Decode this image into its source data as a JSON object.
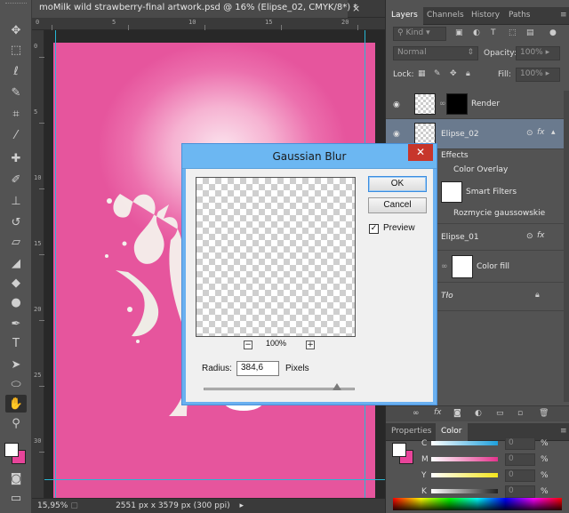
{
  "document": {
    "tab_title": "moMilk wild strawberry-final artwork.psd @ 16% (Elipse_02, CMYK/8*) *",
    "close": "×"
  },
  "status": {
    "zoom": "15,95%",
    "doc_info": "2551 px x 3579 px (300 ppi)"
  },
  "rulers": {
    "top": [
      "0",
      "5",
      "10",
      "15",
      "20"
    ],
    "left": [
      "0",
      "5",
      "10",
      "15",
      "20",
      "25",
      "30"
    ]
  },
  "layers_panel": {
    "tabs": [
      "Layers",
      "Channels",
      "History",
      "Paths"
    ],
    "filter_kind": "Kind",
    "blend_mode": "Normal",
    "opacity_label": "Opacity:",
    "opacity_value": "100%",
    "lock_label": "Lock:",
    "fill_label": "Fill:",
    "fill_value": "100%",
    "layers": [
      {
        "name": "Render"
      },
      {
        "name": "Elipse_02",
        "fx": "fx"
      },
      {
        "name": "Effects"
      },
      {
        "name": "Color Overlay"
      },
      {
        "name": "Smart Filters"
      },
      {
        "name": "Rozmycie gaussowskie"
      },
      {
        "name": "Elipse_01",
        "fx": "fx"
      },
      {
        "name": "Color fill"
      },
      {
        "name": "Tło"
      }
    ]
  },
  "color_panel": {
    "tabs": [
      "Properties",
      "Color"
    ],
    "channels": [
      {
        "label": "C",
        "value": "0",
        "pct": "%",
        "bar_color": "#1ea0dc"
      },
      {
        "label": "M",
        "value": "0",
        "pct": "%",
        "bar_color": "#e4338c"
      },
      {
        "label": "Y",
        "value": "0",
        "pct": "%",
        "bar_color": "#f4e51c"
      },
      {
        "label": "K",
        "value": "0",
        "pct": "%",
        "bar_color": "#222222"
      }
    ]
  },
  "dialog": {
    "title": "Gaussian Blur",
    "ok": "OK",
    "cancel": "Cancel",
    "preview_label": "Preview",
    "preview_checked": "✓",
    "zoom_value": "100%",
    "zoom_minus": "−",
    "zoom_plus": "+",
    "radius_label": "Radius:",
    "radius_value": "384,6",
    "radius_unit": "Pixels",
    "close": "✕"
  },
  "colors": {
    "accent": "#6cb7f2",
    "canvas_pink": "#e6559d",
    "foreground": "#ffffff",
    "background": "#e8449a"
  }
}
